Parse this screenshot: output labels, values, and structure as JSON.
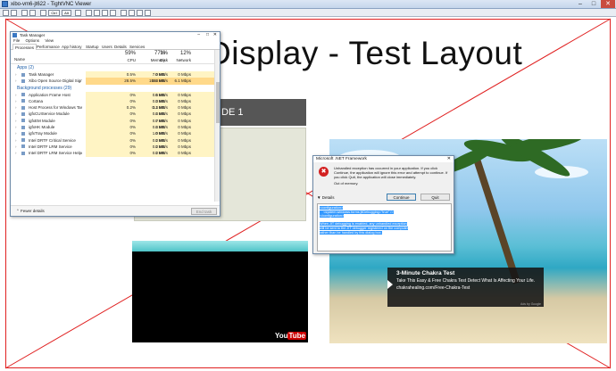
{
  "window": {
    "title": "xibo-vm6-jt622 - TightVNC Viewer",
    "controls": [
      "–",
      "□",
      "✕"
    ]
  },
  "toolbar": {
    "buttons": [
      "new-connection",
      "save",
      "refresh",
      "pause",
      "ctrl-alt-del",
      "ctrl",
      "alt",
      "transfer",
      "zoom-in",
      "zoom-out",
      "zoom-100",
      "fit",
      "fullscreen",
      "options",
      "info",
      "close-connection"
    ],
    "labels": {
      "ctrl": "Ctrl",
      "alt": "Alt"
    }
  },
  "slide": {
    "title": "Display - Test Layout",
    "zone_label": "DE 1"
  },
  "video": {
    "logo": "You",
    "logo_tube": "Tube"
  },
  "ad": {
    "title": "3-Minute Chakra Test",
    "text": "Take This Easy & Free Chakra Test Detect What Is Affecting Your Life.",
    "url": "chakrahealing.com/Free-Chakra-Test",
    "by": "Ads by Google"
  },
  "task_manager": {
    "title": "Task Manager",
    "window_controls": [
      "–",
      "□",
      "✕"
    ],
    "menu": [
      "File",
      "Options",
      "View"
    ],
    "tabs": [
      "Processes",
      "Performance",
      "App history",
      "Startup",
      "Users",
      "Details",
      "Services"
    ],
    "active_tab": "Processes",
    "columns": {
      "name": "Name",
      "cpu_pct": "59%",
      "cpu": "CPU",
      "mem_pct": "77%",
      "mem": "Memory",
      "disk_pct": "1%",
      "disk": "Disk",
      "net_pct": "12%",
      "net": "Network"
    },
    "apps_group": "Apps (2)",
    "apps": [
      {
        "name": "Task Manager",
        "cpu": "0.5%",
        "mem": "7.0 MB",
        "disk": "0 MB/s",
        "net": "0 Mbps"
      },
      {
        "name": "Xibo Open Source Digital Signa...",
        "cpu": "28.5%",
        "mem": "1563 MB",
        "disk": "0.6 MB/s",
        "net": "6.1 Mbps"
      }
    ],
    "bg_group": "Background processes (29)",
    "bg": [
      {
        "name": "Application Frame Host",
        "cpu": "0%",
        "mem": "0.6 MB",
        "disk": "0 MB/s",
        "net": "0 Mbps"
      },
      {
        "name": "Cortana",
        "cpu": "0%",
        "mem": "0.3 MB",
        "disk": "0 MB/s",
        "net": "0 Mbps"
      },
      {
        "name": "Host Process for Windows Tasks",
        "cpu": "0.2%",
        "mem": "3.4 MB",
        "disk": "0.1 MB/s",
        "net": "0 Mbps"
      },
      {
        "name": "igfxCUIService Module",
        "cpu": "0%",
        "mem": "0.4 MB",
        "disk": "0 MB/s",
        "net": "0 Mbps"
      },
      {
        "name": "igfxEM Module",
        "cpu": "0%",
        "mem": "0.7 MB",
        "disk": "0 MB/s",
        "net": "0 Mbps"
      },
      {
        "name": "igfxHK Module",
        "cpu": "0%",
        "mem": "0.4 MB",
        "disk": "0 MB/s",
        "net": "0 Mbps"
      },
      {
        "name": "igfxTray Module",
        "cpu": "0%",
        "mem": "1.0 MB",
        "disk": "0 MB/s",
        "net": "0 Mbps"
      },
      {
        "name": "Intel DRTF Critical Service",
        "cpu": "0%",
        "mem": "0.2 MB",
        "disk": "0 MB/s",
        "net": "0 Mbps"
      },
      {
        "name": "Intel DRTF LRM Service",
        "cpu": "0%",
        "mem": "0.2 MB",
        "disk": "0 MB/s",
        "net": "0 Mbps"
      },
      {
        "name": "Intel DRTF LRM Service Helper",
        "cpu": "0%",
        "mem": "0.2 MB",
        "disk": "0 MB/s",
        "net": "0 Mbps"
      }
    ],
    "fewer_details": "Fewer details",
    "end_task": "End task"
  },
  "dialog": {
    "title": "Microsoft .NET Framework",
    "close": "✕",
    "message": "Unhandled exception has occurred in your application. If you click Continue, the application will ignore this error and attempt to continue. If you click Quit, the application will close immediately.",
    "detail": "Out of memory.",
    "details_label": "Details",
    "continue_label": "Continue",
    "quit_label": "Quit",
    "box_lines": [
      "<configuration>",
      "    <system.windows.forms jitDebugging=\"true\" />",
      "</configuration>",
      "",
      "When JIT debugging is enabled, any unhandled exception",
      "will be sent to the JIT debugger registered on the computer",
      "rather than be handled by this dialog box."
    ]
  },
  "colors": {
    "frame_red": "#e02020",
    "zone_dark": "#565656",
    "zone_light": "#e4e6d9",
    "selection": "#3399ff",
    "error_red": "#d32121"
  }
}
